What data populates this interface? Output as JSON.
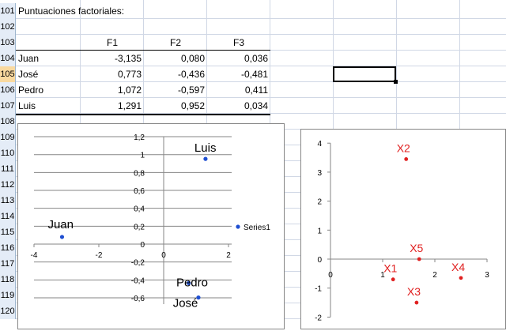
{
  "rows": [
    {
      "num": "101"
    },
    {
      "num": "102"
    },
    {
      "num": "103"
    },
    {
      "num": "104"
    },
    {
      "num": "105"
    },
    {
      "num": "106"
    },
    {
      "num": "107"
    },
    {
      "num": "108"
    },
    {
      "num": "109"
    },
    {
      "num": "110"
    },
    {
      "num": "111"
    },
    {
      "num": "112"
    },
    {
      "num": "113"
    },
    {
      "num": "114"
    },
    {
      "num": "115"
    },
    {
      "num": "116"
    },
    {
      "num": "117"
    },
    {
      "num": "118"
    },
    {
      "num": "119"
    },
    {
      "num": "120"
    }
  ],
  "selected_row": "105",
  "table": {
    "title": "Puntuaciones factoriales:",
    "headers": [
      "F1",
      "F2",
      "F3"
    ],
    "data": [
      {
        "name": "Juan",
        "f1": "-3,135",
        "f2": "0,080",
        "f3": "0,036"
      },
      {
        "name": "José",
        "f1": "0,773",
        "f2": "-0,436",
        "f3": "-0,481"
      },
      {
        "name": "Pedro",
        "f1": "1,072",
        "f2": "-0,597",
        "f3": "0,411"
      },
      {
        "name": "Luis",
        "f1": "1,291",
        "f2": "0,952",
        "f3": "0,034"
      }
    ]
  },
  "colors": {
    "series_blue": "#1f4fd1",
    "series_red": "#e02020",
    "grid": "#d0d7e5",
    "header_bg": "#e4ecf7",
    "header_sel": "#f9d99f"
  },
  "chart_data": [
    {
      "type": "scatter",
      "legend": "Series1",
      "legend_position": "right",
      "xlim": [
        -4,
        2
      ],
      "ylim": [
        -0.6,
        1.2
      ],
      "x_ticks": [
        "-4",
        "-2",
        "0",
        "2"
      ],
      "y_ticks": [
        "1,2",
        "1",
        "0,8",
        "0,6",
        "0,4",
        "0,2",
        "0",
        "-0,2",
        "-0,4",
        "-0,6"
      ],
      "points": [
        {
          "label": "Juan",
          "x": -3.135,
          "y": 0.08
        },
        {
          "label": "José",
          "x": 0.773,
          "y": -0.436
        },
        {
          "label": "Pedro",
          "x": 1.072,
          "y": -0.597
        },
        {
          "label": "Luis",
          "x": 1.291,
          "y": 0.952
        }
      ]
    },
    {
      "type": "scatter",
      "xlim": [
        0,
        3
      ],
      "ylim": [
        -2,
        4
      ],
      "x_ticks": [
        "0",
        "1",
        "2",
        "3"
      ],
      "y_ticks": [
        "4",
        "3",
        "2",
        "1",
        "0",
        "-1",
        "-2"
      ],
      "points": [
        {
          "label": "X1",
          "x": 1.2,
          "y": -0.7
        },
        {
          "label": "X2",
          "x": 1.45,
          "y": 3.45
        },
        {
          "label": "X3",
          "x": 1.65,
          "y": -1.5
        },
        {
          "label": "X4",
          "x": 2.5,
          "y": -0.65
        },
        {
          "label": "X5",
          "x": 1.7,
          "y": 0.0
        }
      ]
    }
  ]
}
